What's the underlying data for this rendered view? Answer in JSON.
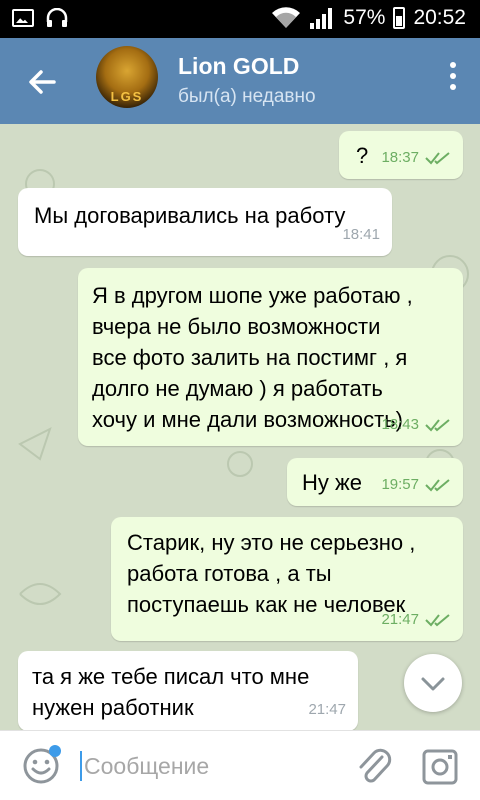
{
  "status_bar": {
    "battery": "57%",
    "time": "20:52"
  },
  "header": {
    "title": "Lion GOLD",
    "subtitle": "был(а) недавно"
  },
  "messages": [
    {
      "dir": "out",
      "text": "?",
      "time": "18:37"
    },
    {
      "dir": "in",
      "text": "Мы договаривались на работу",
      "time": "18:41"
    },
    {
      "dir": "out",
      "text": "Я в другом шопе уже работаю ,\nвчера не было возможности\nвсе фото залить на постимг , я\nдолго не думаю ) я работать\nхочу и мне дали возможность)",
      "time": "18:43"
    },
    {
      "dir": "out",
      "text": "Ну же",
      "time": "19:57"
    },
    {
      "dir": "out",
      "text": "Старик, ну это не серьезно ,\nработа готова , а ты\nпоступаешь как не человек",
      "time": "21:47"
    },
    {
      "dir": "in",
      "text": "та я же тебе писал что мне\nнужен работник",
      "time": "21:47"
    }
  ],
  "input": {
    "placeholder": "Сообщение"
  },
  "colors": {
    "header": "#5b87b3",
    "outgoing_bubble": "#effdde",
    "incoming_bubble": "#ffffff",
    "accent": "#3d9be9"
  },
  "icons": [
    "image-icon",
    "headphones-icon",
    "wifi-icon",
    "signal-icon",
    "battery-icon",
    "back-arrow-icon",
    "more-icon",
    "read-ticks-icon",
    "chevron-down-icon",
    "smile-icon",
    "attach-icon",
    "instagram-icon"
  ]
}
